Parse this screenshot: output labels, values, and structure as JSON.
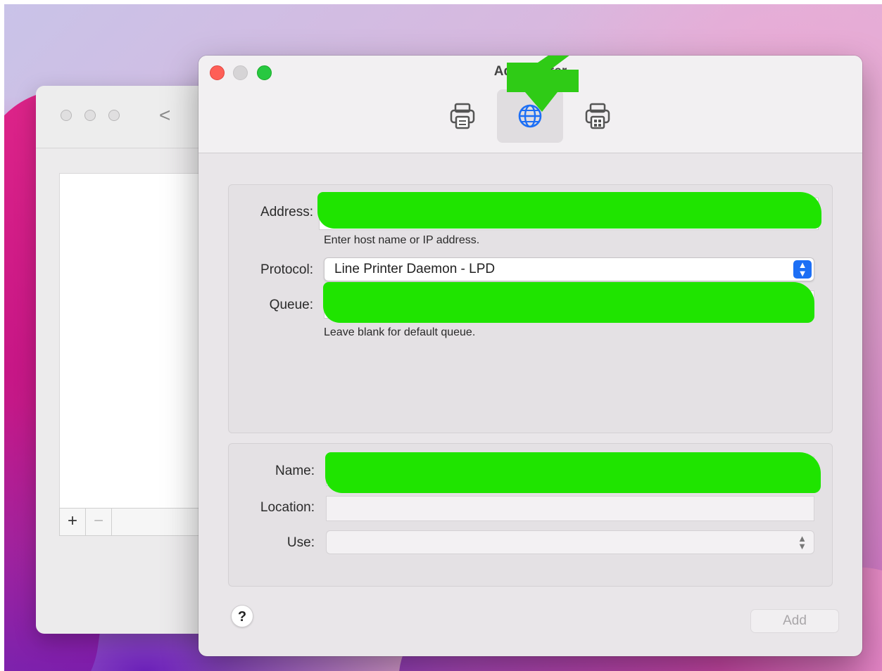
{
  "window": {
    "title": "Add Printer"
  },
  "toolbar": {
    "tabs": [
      {
        "name": "default",
        "icon": "printer-icon",
        "selected": false
      },
      {
        "name": "ip",
        "icon": "globe-icon",
        "selected": true
      },
      {
        "name": "windows",
        "icon": "windows-printer-icon",
        "selected": false
      }
    ]
  },
  "form": {
    "address": {
      "label": "Address:",
      "value": "",
      "hint": "Enter host name or IP address."
    },
    "protocol": {
      "label": "Protocol:",
      "value": "Line Printer Daemon - LPD"
    },
    "queue": {
      "label": "Queue:",
      "value": "",
      "hint": "Leave blank for default queue."
    },
    "name": {
      "label": "Name:",
      "value": ""
    },
    "location": {
      "label": "Location:",
      "value": ""
    },
    "use": {
      "label": "Use:",
      "value": ""
    }
  },
  "footer": {
    "help_label": "?",
    "add_label": "Add"
  },
  "back_window": {
    "chevron": "<",
    "add_label": "+",
    "remove_label": "−"
  },
  "colors": {
    "redaction": "#1fe400",
    "accent": "#1d6ff5",
    "close": "#fe5f57",
    "zoom": "#28c840"
  }
}
